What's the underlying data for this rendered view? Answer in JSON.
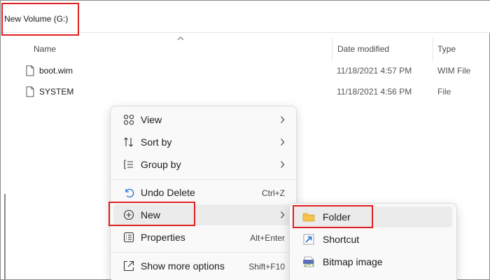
{
  "address_bar": {
    "path": "New Volume (G:)"
  },
  "columns": {
    "name": "Name",
    "date_modified": "Date modified",
    "type": "Type"
  },
  "files": [
    {
      "name": "boot.wim",
      "date": "11/18/2021 4:57 PM",
      "type": "WIM File"
    },
    {
      "name": "SYSTEM",
      "date": "11/18/2021 4:56 PM",
      "type": "File"
    }
  ],
  "context_menu": {
    "items": [
      {
        "label": "View",
        "icon": "grid-view-icon",
        "submenu": true
      },
      {
        "label": "Sort by",
        "icon": "sort-icon",
        "submenu": true
      },
      {
        "label": "Group by",
        "icon": "group-icon",
        "submenu": true
      },
      {
        "label": "Undo Delete",
        "icon": "undo-icon",
        "shortcut": "Ctrl+Z"
      },
      {
        "label": "New",
        "icon": "plus-circle-icon",
        "submenu": true,
        "active": true
      },
      {
        "label": "Properties",
        "icon": "properties-icon",
        "shortcut": "Alt+Enter"
      },
      {
        "label": "Show more options",
        "icon": "show-more-icon",
        "shortcut": "Shift+F10"
      }
    ]
  },
  "new_submenu": {
    "items": [
      {
        "label": "Folder",
        "icon": "folder-icon",
        "active": true
      },
      {
        "label": "Shortcut",
        "icon": "shortcut-icon"
      },
      {
        "label": "Bitmap image",
        "icon": "bitmap-icon"
      }
    ]
  },
  "colors": {
    "highlight": "#e02020",
    "folder": "#f4c44e",
    "accent": "#1f6fd1"
  }
}
